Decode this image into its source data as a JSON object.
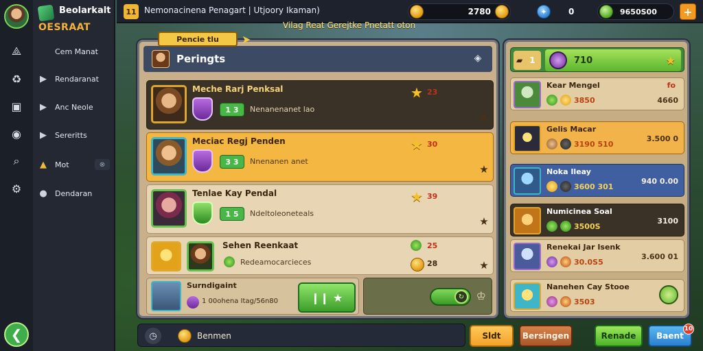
{
  "colors": {
    "accent": "#f1b534",
    "panel": "#c9b08a",
    "positive": "#49b648",
    "sidebar": "#232833"
  },
  "brand": {
    "name": "Beolarkalt",
    "subtitle": "OESRAAT"
  },
  "sidebar": {
    "items": [
      {
        "label": "Cem Manat",
        "icon": "chart-icon",
        "glyph": ""
      },
      {
        "label": "Rendaranat",
        "icon": "play-icon",
        "glyph": "▶"
      },
      {
        "label": "Anc Neole",
        "icon": "play-icon",
        "glyph": "▶"
      },
      {
        "label": "Sereritts",
        "icon": "play-icon",
        "glyph": "▶"
      },
      {
        "label": "Mot",
        "icon": "warning-icon",
        "glyph": "▲",
        "chip": "⊗"
      },
      {
        "label": "Dendaran",
        "icon": "chat-icon",
        "glyph": "●"
      }
    ],
    "rail_icons": [
      "badge-icon",
      "recycle-icon",
      "window-icon",
      "location-icon",
      "search-icon",
      "settings-icon"
    ],
    "back_glyph": "❮"
  },
  "topbar": {
    "badge": "11",
    "title": "Nemonacinena Penagart | Utjoory Ikaman)",
    "gold": "2780",
    "blue_glyph": "✦",
    "blue_count": "0",
    "gems": "9650S00",
    "plus": "+"
  },
  "banner": "Vilag Reat Gerejtke Pnetatt oton",
  "tag": "Pencie tlu",
  "main_panel": {
    "title": "Peringts",
    "close_glyph": "◈",
    "rows": [
      {
        "name": "Meche Rarj Penksal",
        "level": "1 3",
        "desc": "Nenanenanet lao",
        "count": "23"
      },
      {
        "name": "Meciac Regj Penden",
        "level": "3 3",
        "desc": "Nnenanen anet",
        "count": "30"
      },
      {
        "name": "Tenlae Kay Pendal",
        "level": "1 5",
        "desc": "Ndeltoleoneteals",
        "count": "39"
      },
      {
        "name": "Sehen Reenkaat",
        "count_top": "25",
        "desc": "Redeamocarcieces",
        "count": "28"
      }
    ],
    "footer": {
      "name": "Surndigaint",
      "desc": "1 00ohena Itag/56n80",
      "button_glyph": "❙❙ ★"
    },
    "toggle_ext": "♔"
  },
  "side_panel": {
    "head_count": "1",
    "head_value": "710",
    "items": [
      {
        "name": "Kear Mengel",
        "value": "3850",
        "right": "4660",
        "top": "fo"
      },
      {
        "name": "Gelis Macar",
        "value": "3190 510",
        "right": "3.500 0"
      },
      {
        "name": "Noka Ileay",
        "value": "3600 301",
        "right": "940 0.00"
      },
      {
        "name": "Numicinea Soal",
        "value": "3500S",
        "right": "3100"
      },
      {
        "name": "Renekai Jar Isenk",
        "value": "30.0S5",
        "right": "3.600 01"
      },
      {
        "name": "Nanehen Cay Stooe",
        "value": "3503"
      }
    ]
  },
  "bottombar": {
    "clock_glyph": "◷",
    "text": "Benmen"
  },
  "buttons": {
    "b1": "Sldt",
    "b2": "Bersingen",
    "b3": "Renade",
    "b4": "Baent"
  },
  "notif": "10"
}
